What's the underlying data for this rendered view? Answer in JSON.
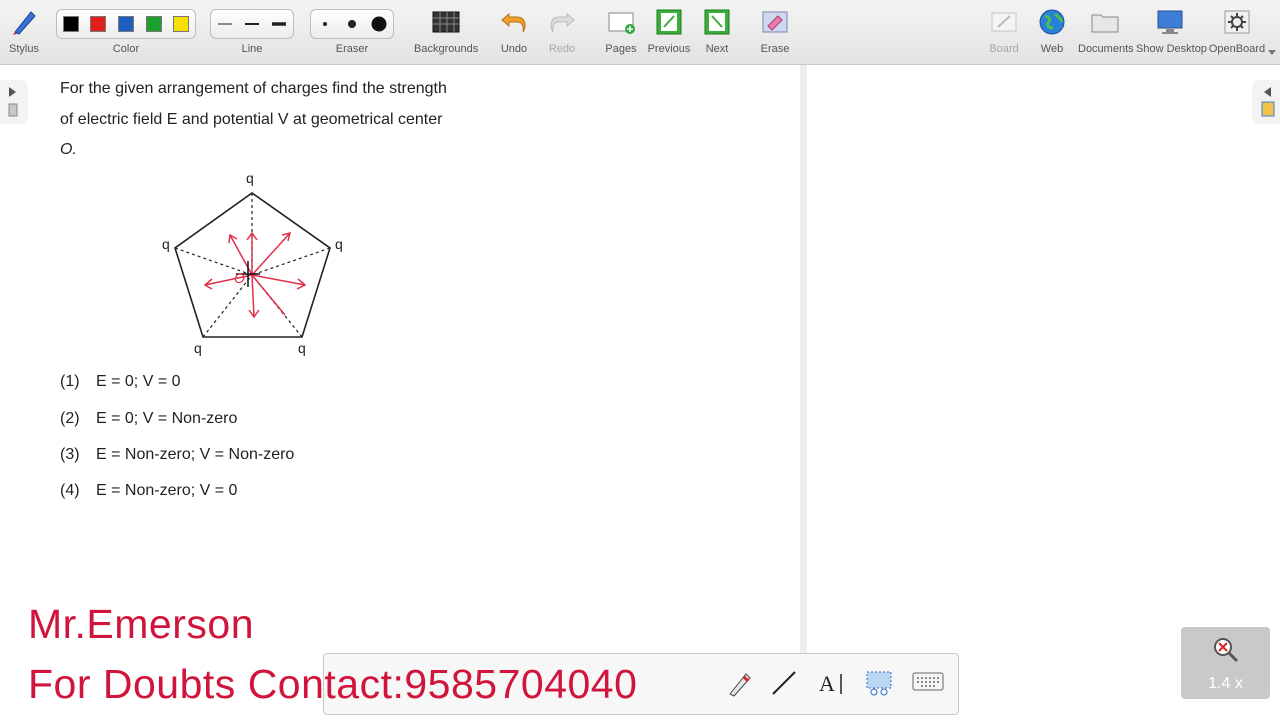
{
  "toolbar": {
    "stylus": "Stylus",
    "color": "Color",
    "line": "Line",
    "eraser": "Eraser",
    "backgrounds": "Backgrounds",
    "undo": "Undo",
    "redo": "Redo",
    "pages": "Pages",
    "previous": "Previous",
    "next": "Next",
    "erase": "Erase",
    "board": "Board",
    "web": "Web",
    "documents": "Documents",
    "show_desktop": "Show Desktop",
    "openboard": "OpenBoard",
    "colors": [
      "#000000",
      "#e01e1e",
      "#1f5fbf",
      "#1e9e2e",
      "#f5e000"
    ]
  },
  "question": {
    "line1": "For the given arrangement of charges find the strength",
    "line2": "of electric field E and potential V at geometrical center",
    "line3": "O."
  },
  "diagram": {
    "charge_label": "q",
    "center_label": "O"
  },
  "options": [
    {
      "num": "(1)",
      "text": "E = 0; V = 0"
    },
    {
      "num": "(2)",
      "text": "E = 0; V = Non-zero"
    },
    {
      "num": "(3)",
      "text": "E = Non-zero; V = Non-zero"
    },
    {
      "num": "(4)",
      "text": "E = Non-zero; V = 0"
    }
  ],
  "branding": {
    "name": "Mr.Emerson",
    "contact": "For Doubts Contact:9585704040"
  },
  "zoom": {
    "level": "1.4 x"
  }
}
